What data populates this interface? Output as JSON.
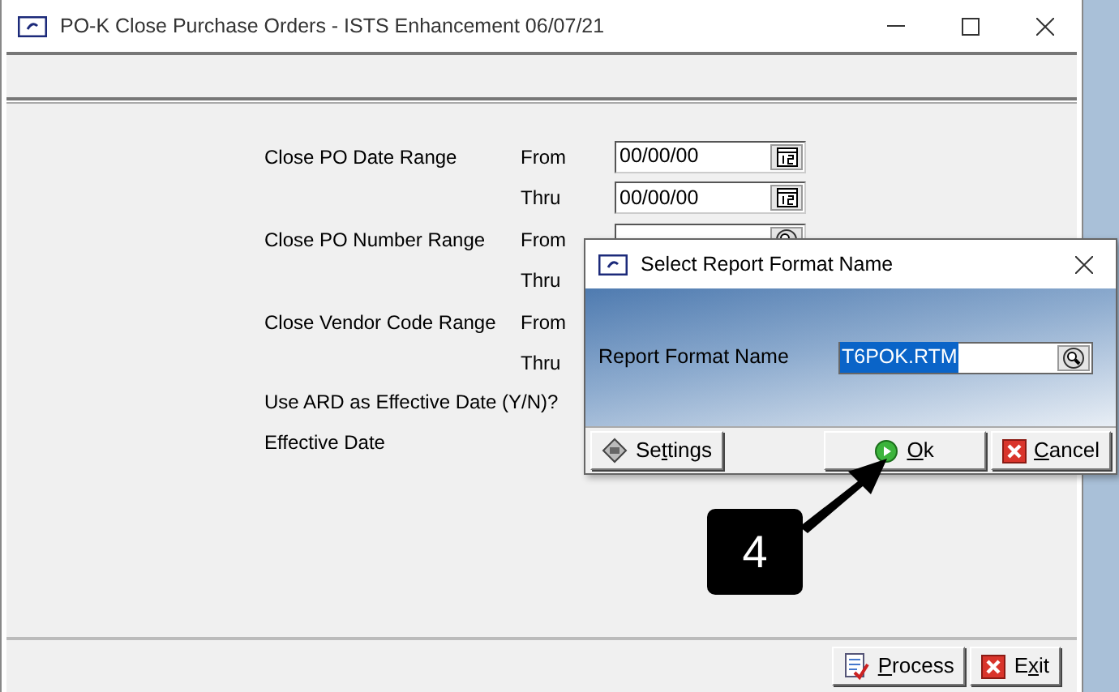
{
  "window": {
    "title": "PO-K  Close Purchase Orders - ISTS Enhancement 06/07/21"
  },
  "form_rows": [
    {
      "label": "Close PO Date Range",
      "range": "From",
      "field": {
        "value": "00/00/00",
        "kind": "calendar"
      }
    },
    {
      "range": "Thru",
      "field": {
        "value": "00/00/00",
        "kind": "calendar"
      }
    },
    {
      "label": "Close PO Number Range",
      "range": "From",
      "field": {
        "kind": "lookup"
      }
    },
    {
      "range": "Thru"
    },
    {
      "label": "Close Vendor Code Range",
      "range": "From"
    },
    {
      "range": "Thru"
    },
    {
      "label": "Use ARD as Effective Date (Y/N)?"
    },
    {
      "label": "Effective Date"
    }
  ],
  "dialog": {
    "title": "Select Report Format Name",
    "field_label": "Report Format Name",
    "field_value": "T6POK.RTM",
    "field_selected": true,
    "buttons": [
      {
        "before": "Se",
        "underlined": "t",
        "after": "tings",
        "kind": "settings"
      },
      {
        "underlined": "O",
        "after": "k",
        "kind": "ok"
      },
      {
        "underlined": "C",
        "after": "ancel",
        "kind": "cancel"
      }
    ]
  },
  "callout": {
    "label": "4"
  },
  "footer_buttons": [
    {
      "underlined": "P",
      "after": "rocess",
      "kind": "process"
    },
    {
      "before": "E",
      "underlined": "x",
      "after": "it",
      "kind": "exit"
    }
  ]
}
